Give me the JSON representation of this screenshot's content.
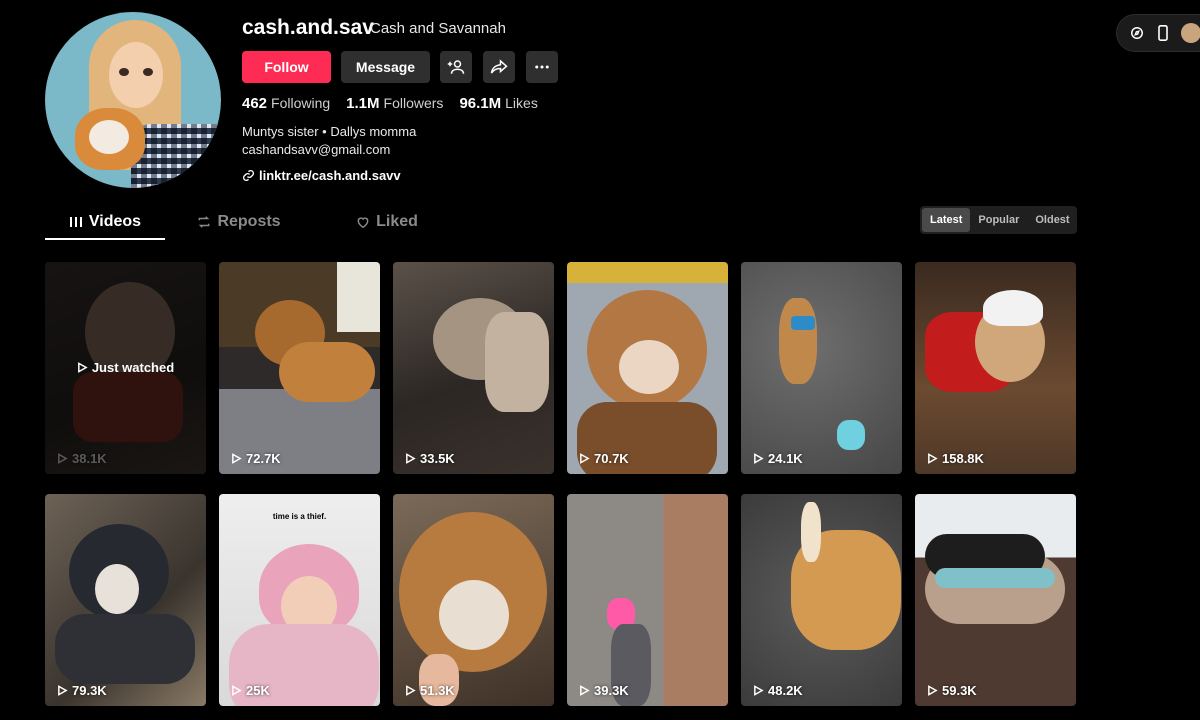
{
  "profile": {
    "username": "cash.and.sav",
    "nickname": "Cash and Savannah",
    "follow_label": "Follow",
    "message_label": "Message",
    "stats": [
      {
        "value": "462",
        "label": "Following"
      },
      {
        "value": "1.1M",
        "label": "Followers"
      },
      {
        "value": "96.1M",
        "label": "Likes"
      }
    ],
    "bio_line1": "Muntys sister • Dallys momma",
    "bio_line2": "cashandsavv@gmail.com",
    "link": "linktr.ee/cash.and.savv"
  },
  "tabs": [
    {
      "label": "Videos",
      "icon": "grid-bars-icon",
      "active": true
    },
    {
      "label": "Reposts",
      "icon": "repost-icon",
      "active": false
    },
    {
      "label": "Liked",
      "icon": "heart-outline-icon",
      "active": false
    }
  ],
  "sort": {
    "options": [
      "Latest",
      "Popular",
      "Oldest"
    ],
    "selected": "Latest"
  },
  "videos": [
    {
      "views": "38.1K",
      "status": "Just watched"
    },
    {
      "views": "72.7K"
    },
    {
      "views": "33.5K"
    },
    {
      "views": "70.7K"
    },
    {
      "views": "24.1K"
    },
    {
      "views": "158.8K"
    },
    {
      "views": "79.3K"
    },
    {
      "views": "25K",
      "caption": "time is a thief."
    },
    {
      "views": "51.3K"
    },
    {
      "views": "39.3K"
    },
    {
      "views": "48.2K"
    },
    {
      "views": "59.3K"
    }
  ],
  "colors": {
    "accent": "#fe2c55",
    "button_bg": "#2f2f2f",
    "background": "#000000"
  }
}
